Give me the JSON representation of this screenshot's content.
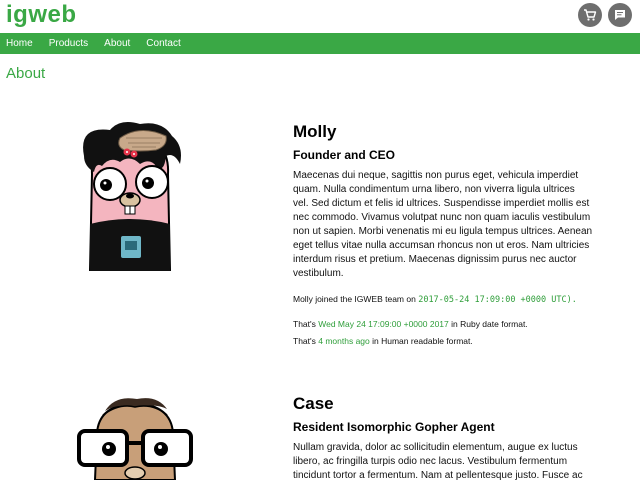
{
  "brand": "igweb",
  "nav": [
    "Home",
    "Products",
    "About",
    "Contact"
  ],
  "page_title": "About",
  "icons": {
    "cart": "shopping-cart-icon",
    "chat": "chat-icon"
  },
  "colors": {
    "accent": "#3aa845",
    "link": "#2f9e3a",
    "icon_circle": "#6e6e6e"
  },
  "profiles": [
    {
      "name": "Molly",
      "title": "Founder and CEO",
      "bio": "Maecenas dui neque, sagittis non purus eget, vehicula imperdiet quam. Nulla condimentum urna libero, non viverra ligula ultrices vel. Sed dictum et felis id ultrices. Suspendisse imperdiet mollis est nec commodo. Vivamus volutpat nunc non quam iaculis vestibulum non ut sapien. Morbi venenatis mi eu ligula tempus ultrices. Aenean eget tellus vitae nulla accumsan rhoncus non ut eros. Nam ultricies interdum risus et pretium. Maecenas dignissim purus nec auctor vestibulum.",
      "joined_prefix": "Molly joined the IGWEB team on ",
      "joined_date": "2017-05-24 17:09:00 +0000 UTC).",
      "ruby_prefix": "That's ",
      "ruby_date": "Wed May 24 17:09:00 +0000 2017",
      "ruby_suffix": " in Ruby date format.",
      "human_prefix": "That's ",
      "human_value": "4 months ago",
      "human_suffix": " in Human readable format."
    },
    {
      "name": "Case",
      "title": "Resident Isomorphic Gopher Agent",
      "bio": "Nullam gravida, dolor ac sollicitudin elementum, augue ex luctus libero, ac fringilla turpis odio nec lacus. Vestibulum fermentum tincidunt tortor a fermentum. Nam at pellentesque justo. Fusce ac"
    }
  ]
}
